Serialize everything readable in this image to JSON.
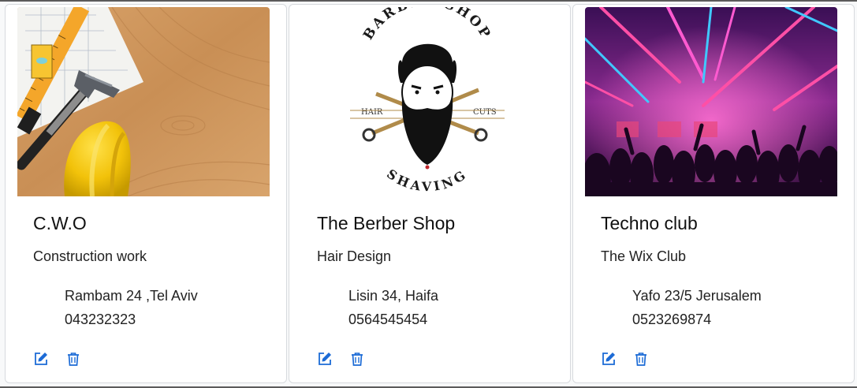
{
  "cards": [
    {
      "title": "C.W.O",
      "subtitle": "Construction work",
      "address": "Rambam 24 ,Tel Aviv",
      "phone": "043232323",
      "image_icon": "construction-tools-image"
    },
    {
      "title": "The Berber Shop",
      "subtitle": "Hair Design",
      "address": "Lisin 34, Haifa",
      "phone": "0564545454",
      "image_icon": "barber-shop-logo-image",
      "logo": {
        "top_text": "BARBER SHOP",
        "left_text": "HAIR",
        "right_text": "CUTS",
        "bottom_text": "SHAVING"
      }
    },
    {
      "title": "Techno club",
      "subtitle": "The Wix Club",
      "address": "Yafo 23/5 Jerusalem",
      "phone": "0523269874",
      "image_icon": "nightclub-crowd-image"
    }
  ],
  "actions": {
    "edit_icon": "edit-icon",
    "delete_icon": "trash-icon"
  },
  "colors": {
    "icon_blue": "#1c6bd6",
    "card_border": "#d7dade"
  }
}
